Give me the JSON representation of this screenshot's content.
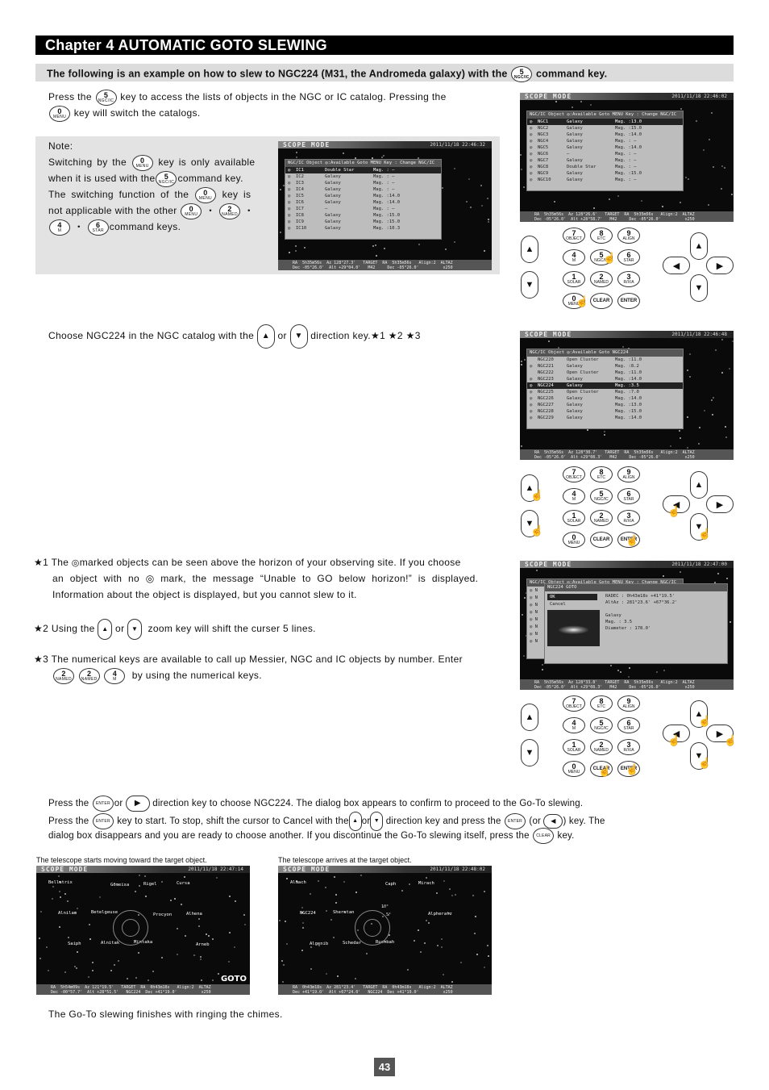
{
  "chapter": {
    "title": "Chapter 4  AUTOMATIC GOTO SLEWING"
  },
  "banner": {
    "text_before": "The following is an example on how to slew to NGC224 (M31, the Andromeda galaxy) with the",
    "text_after": "command key."
  },
  "keys": {
    "k5": {
      "num": "5",
      "sub": "NGC/IC"
    },
    "k0": {
      "num": "0",
      "sub": "MENU"
    },
    "k2": {
      "num": "2",
      "sub": "NAMED"
    },
    "k4": {
      "num": "4",
      "sub": "M"
    },
    "k6": {
      "num": "6",
      "sub": "STAR"
    },
    "enter": "ENTER",
    "clear": "CLEAR",
    "up": "▲",
    "down": "▼",
    "left": "◀",
    "right": "▶"
  },
  "keypad": {
    "rows": [
      [
        {
          "num": "7",
          "sub": "OBJECT"
        },
        {
          "num": "8",
          "sub": "ETC"
        },
        {
          "num": "9",
          "sub": "ALIGN"
        }
      ],
      [
        {
          "num": "4",
          "sub": "M"
        },
        {
          "num": "5",
          "sub": "NGC/IC"
        },
        {
          "num": "6",
          "sub": "STAR"
        }
      ],
      [
        {
          "num": "1",
          "sub": "SOLAR"
        },
        {
          "num": "2",
          "sub": "NAMED"
        },
        {
          "num": "3",
          "sub": "R/X/A"
        }
      ],
      [
        {
          "num": "0",
          "sub": "MENU"
        },
        {
          "num": "CLEAR",
          "sub": ""
        },
        {
          "num": "ENTER",
          "sub": ""
        }
      ]
    ]
  },
  "step1": {
    "line1_a": "Press the",
    "line1_b": "key to access the lists of objects in the NGC or IC catalog.  Pressing the",
    "line2": "key will switch the catalogs."
  },
  "note": {
    "title": "Note:",
    "l1a": "Switching by the",
    "l1b": "key is only available",
    "l2a": "when it is used with the",
    "l2b": "command key.",
    "l3a": "The switching function of the",
    "l3b": "key is",
    "l4a": "not applicable with the other",
    "sep": "・",
    "l5b": "command keys."
  },
  "step2": {
    "a": "Choose NGC224 in the NGC catalog with the",
    "or": "or",
    "b": "direction key.★1 ★2 ★3"
  },
  "footnotes": {
    "f1_l1a": "★1 The",
    "f1_l1b": "marked objects can be seen above the horizon of your observing site.  If you choose",
    "f1_l2": "an object with no ◎ mark, the message “Unable to GO below horizon!” is displayed.",
    "f1_l3": "Information about the object is displayed, but you cannot slew to it.",
    "f2a": "★2 Using the",
    "f2or": "or",
    "f2b": "zoom key will shift the curser 5 lines.",
    "f3_l1": "★3 The numerical keys are available to call up Messier, NGC and IC objects by number.  Enter",
    "f3_l2": "by using the numerical keys."
  },
  "step3": {
    "l1a": "Press the",
    "l1or": "or",
    "l1b": "direction key to choose NGC224.  The dialog box appears to confirm to proceed to the Go-To slewing.",
    "l2a": "Press the",
    "l2b": "key to start.  To stop, shift the cursor to Cancel with the",
    "l2or": "or",
    "l2c": "direction key and press the",
    "l2d": "(or",
    "l2e": ") key.  The",
    "l3a": "dialog box disappears and you are ready to choose another.  If you discontinue the Go-To slewing itself, press the",
    "l3b": "key."
  },
  "captions": {
    "moving": "The telescope starts moving toward the target object.",
    "arrives": "The telescope arrives at the target object."
  },
  "final": "The Go-To slewing finishes with ringing the chimes.",
  "page_number": "43",
  "screens": {
    "mode_label": "SCOPE MODE",
    "ic_list": {
      "time": "2011/11/18 22:46:32",
      "header": "NGC/IC Object   ◎:Available Goto   MENU Key : Change NGC/IC",
      "rows": [
        {
          "mark": "◎",
          "id": "IC1",
          "type": "Double Star",
          "mag": "Mag. : —",
          "sel": true
        },
        {
          "mark": "◎",
          "id": "IC2",
          "type": "Galaxy",
          "mag": "Mag. : —"
        },
        {
          "mark": "◎",
          "id": "IC3",
          "type": "Galaxy",
          "mag": "Mag. : —"
        },
        {
          "mark": "◎",
          "id": "IC4",
          "type": "Galaxy",
          "mag": "Mag. : —"
        },
        {
          "mark": "◎",
          "id": "IC5",
          "type": "Galaxy",
          "mag": "Mag. :14.0"
        },
        {
          "mark": "◎",
          "id": "IC6",
          "type": "Galaxy",
          "mag": "Mag. :14.0"
        },
        {
          "mark": "◎",
          "id": "IC7",
          "type": "—",
          "mag": "Mag. : —"
        },
        {
          "mark": "◎",
          "id": "IC8",
          "type": "Galaxy",
          "mag": "Mag. :15.0"
        },
        {
          "mark": "◎",
          "id": "IC9",
          "type": "Galaxy",
          "mag": "Mag. :15.0"
        },
        {
          "mark": "◎",
          "id": "IC10",
          "type": "Galaxy",
          "mag": "Mag. :10.3"
        }
      ],
      "status": [
        "RA  5h35m56s  Az 128°27.3'   TARGET  RA  5h35m56s   Align:2  ALTAZ",
        "Dec -05°26.0'  Alt +29°04.0'   M42     Dec -05°26.0'          x250"
      ]
    },
    "ngc_list": {
      "time": "2011/11/18 22:46:02",
      "header": "NGC/IC Object   ◎:Available Goto   MENU Key : Change NGC/IC",
      "rows": [
        {
          "mark": "◎",
          "id": "NGC1",
          "type": "Galaxy",
          "mag": "Mag. :13.0",
          "sel": true
        },
        {
          "mark": "◎",
          "id": "NGC2",
          "type": "Galaxy",
          "mag": "Mag. :15.0"
        },
        {
          "mark": "◎",
          "id": "NGC3",
          "type": "Galaxy",
          "mag": "Mag. :14.0"
        },
        {
          "mark": "◎",
          "id": "NGC4",
          "type": "Galaxy",
          "mag": "Mag. : —"
        },
        {
          "mark": "◎",
          "id": "NGC5",
          "type": "Galaxy",
          "mag": "Mag. :14.0"
        },
        {
          "mark": "◎",
          "id": "NGC6",
          "type": "—",
          "mag": "Mag. : —"
        },
        {
          "mark": "◎",
          "id": "NGC7",
          "type": "Galaxy",
          "mag": "Mag. : —"
        },
        {
          "mark": "◎",
          "id": "NGC8",
          "type": "Double Star",
          "mag": "Mag. : —"
        },
        {
          "mark": "◎",
          "id": "NGC9",
          "type": "Galaxy",
          "mag": "Mag. :15.0"
        },
        {
          "mark": "◎",
          "id": "NGC10",
          "type": "Galaxy",
          "mag": "Mag. : —"
        }
      ],
      "status": [
        "RA  5h35m56s  Az 128°26.6'   TARGET  RA  5h35m56s   Align:2  ALTAZ",
        "Dec -05°26.0'  Alt +28°58.7'   M42     Dec -05°26.0'          x250"
      ]
    },
    "ngc224_list": {
      "time": "2011/11/18 22:46:48",
      "header": "NGC/IC Object   ◎:Available Goto                     NGC224",
      "rows": [
        {
          "mark": "",
          "id": "NGC220",
          "type": "Open Cluster",
          "mag": "Mag. :11.0"
        },
        {
          "mark": "◎",
          "id": "NGC221",
          "type": "Galaxy",
          "mag": "Mag. :8.2"
        },
        {
          "mark": "",
          "id": "NGC222",
          "type": "Open Cluster",
          "mag": "Mag. :11.0"
        },
        {
          "mark": "◎",
          "id": "NGC223",
          "type": "Galaxy",
          "mag": "Mag. :14.0"
        },
        {
          "mark": "◎",
          "id": "NGC224",
          "type": "Galaxy",
          "mag": "Mag. :3.5",
          "sel": true
        },
        {
          "mark": "◎",
          "id": "NGC225",
          "type": "Open Cluster",
          "mag": "Mag. :7.0"
        },
        {
          "mark": "◎",
          "id": "NGC226",
          "type": "Galaxy",
          "mag": "Mag. :14.0"
        },
        {
          "mark": "◎",
          "id": "NGC227",
          "type": "Galaxy",
          "mag": "Mag. :13.0"
        },
        {
          "mark": "◎",
          "id": "NGC228",
          "type": "Galaxy",
          "mag": "Mag. :15.0"
        },
        {
          "mark": "◎",
          "id": "NGC229",
          "type": "Galaxy",
          "mag": "Mag. :14.0"
        }
      ],
      "status": [
        "RA  5h35m56s  Az 128°30.7'   TARGET  RA  5h35m56s   Align:2  ALTAZ",
        "Dec -05°26.0'  Alt +29°08.3'   M42     Dec -05°26.0'          x250"
      ]
    },
    "goto_dialog": {
      "time": "2011/11/18 22:47:00",
      "header": "NGC/IC Object   ◎:Available Goto   MENU Key : Change NGC/IC",
      "title": "NGC224      GOTO",
      "options": [
        "OK",
        "Cancel"
      ],
      "info": [
        "RADEC :  0h43m18s +41°19.5'",
        "AltAz : 281°23.6' +67°36.2'",
        "",
        "Galaxy",
        "Mag.  : 3.5",
        "Diameter  : 178.0'"
      ],
      "status": [
        "RA  5h35m56s  Az 128°33.8'   TARGET  RA  5h35m56s   Align:2  ALTAZ",
        "Dec -05°26.0'  Alt +29°08.3'   M42     Dec -05°26.0'          x250"
      ]
    },
    "moving": {
      "time": "2011/11/18 22:47:14",
      "labels": [
        "Bellatrix",
        "Betelgeuse",
        "Mintaka",
        "Cursa",
        "Alnilam",
        "Alnitak",
        "Rigel",
        "Alhena",
        "Saiph",
        "Gomeisa",
        "Procyon",
        "Arneb"
      ],
      "goto_label": "GOTO",
      "status": [
        "RA  5h54m09s  Az 121°19.5'   TARGET  RA  0h43m18s   Align:2  ALTAZ",
        "Dec -00°57.7'  Alt +28°51.5'   NGC224  Dec +41°19.0'          x250"
      ]
    },
    "arrives": {
      "time": "2011/11/18 22:48:02",
      "labels": [
        "Almach",
        "Sheratan",
        "Ruchbah",
        "Mirach",
        "NGC224",
        "Schedar",
        "Caph",
        "Alpheratz",
        "Algenib"
      ],
      "fov_labels": [
        "10°",
        "5°"
      ],
      "status": [
        "RA  0h43m18s  Az 281°23.4'   TARGET  RA  0h43m18s   Align:2  ALTAZ",
        "Dec +41°19.0'  Alt +67°24.0'   NGC224  Dec +41°19.0'          x250"
      ]
    }
  }
}
